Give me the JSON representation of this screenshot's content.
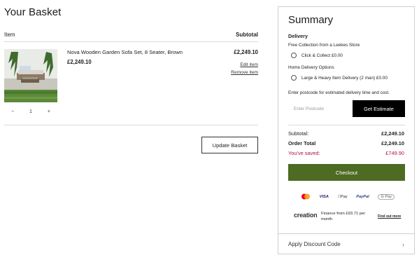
{
  "basket": {
    "title": "Your Basket",
    "col_item": "Item",
    "col_subtotal": "Subtotal",
    "product": {
      "name": "Nova Wooden Garden Sofa Set, 8 Seater, Brown",
      "price": "£2,249.10",
      "line_total": "£2,249.10",
      "edit_label": "Edit item",
      "remove_label": "Remove item",
      "qty_minus": "−",
      "qty_value": "1",
      "qty_plus": "+"
    },
    "update_label": "Update Basket"
  },
  "summary": {
    "title": "Summary",
    "delivery_heading": "Delivery",
    "free_collection_heading": "Free Collection from a Leekes Store",
    "click_collect_label": "Click & Collect £0.00",
    "home_delivery_heading": "Home Delivery Options",
    "large_delivery_label": "Large & Heavy Item Delivery (2 man) £0.00",
    "postcode_hint": "Enter postcode for estimated delivery time and cost.",
    "postcode_placeholder": "Enter Postcode",
    "estimate_label": "Get Estimate",
    "subtotal_label": "Subtotal:",
    "subtotal_value": "£2,249.10",
    "order_total_label": "Order Total",
    "order_total_value": "£2,249.10",
    "saved_label": "You've saved:",
    "saved_value": "£749.90",
    "checkout_label": "Checkout",
    "payments": {
      "visa": "VISA",
      "apple_pay": "Pay",
      "paypal": "PayPal",
      "google_pay": "G Pay"
    },
    "finance_logo": "creation",
    "finance_text": "Finance from £93.71 per month",
    "find_more_label": "Find out more",
    "discount_label": "Apply Discount Code",
    "discount_chevron": "›"
  },
  "colors": {
    "checkout_green": "#4d6b23",
    "saved_red": "#b5103c",
    "estimate_black": "#000000"
  }
}
